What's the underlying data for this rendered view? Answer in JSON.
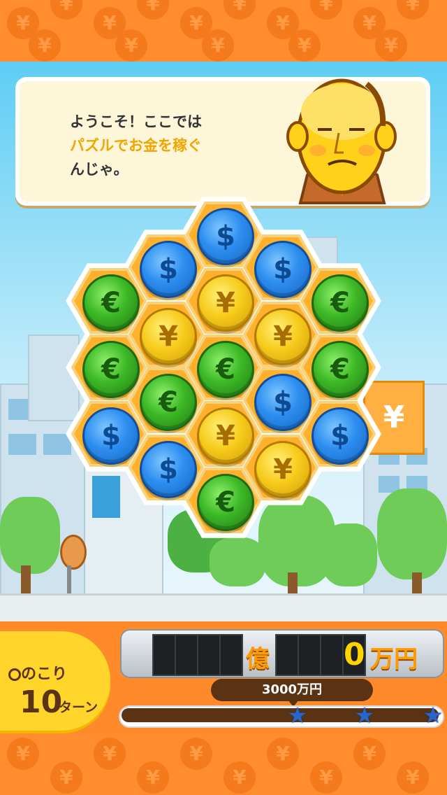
{
  "dialog": {
    "line1": "ようこそ！ここでは",
    "line2": "パズルでお金を稼ぐ",
    "line3": "んじゃ。"
  },
  "board": {
    "coins": [
      {
        "type": "blue",
        "symbol": "$"
      },
      {
        "type": "blue",
        "symbol": "$"
      },
      {
        "type": "blue",
        "symbol": "$"
      },
      {
        "type": "green",
        "symbol": "€"
      },
      {
        "type": "yellow",
        "symbol": "¥"
      },
      {
        "type": "green",
        "symbol": "€"
      },
      {
        "type": "yellow",
        "symbol": "¥"
      },
      {
        "type": "yellow",
        "symbol": "¥"
      },
      {
        "type": "green",
        "symbol": "€"
      },
      {
        "type": "green",
        "symbol": "€"
      },
      {
        "type": "green",
        "symbol": "€"
      },
      {
        "type": "green",
        "symbol": "€"
      },
      {
        "type": "blue",
        "symbol": "$"
      },
      {
        "type": "blue",
        "symbol": "$"
      },
      {
        "type": "yellow",
        "symbol": "¥"
      },
      {
        "type": "blue",
        "symbol": "$"
      },
      {
        "type": "blue",
        "symbol": "$"
      },
      {
        "type": "yellow",
        "symbol": "¥"
      },
      {
        "type": "green",
        "symbol": "€"
      }
    ]
  },
  "status": {
    "turns_label": "のこり",
    "turns_value": "10",
    "turns_unit": "ターン",
    "money_oku_digits": [
      "",
      "",
      "",
      ""
    ],
    "money_oku_unit": "億",
    "money_man_digits": [
      "",
      "",
      "",
      "0"
    ],
    "money_man_unit": "万円",
    "goal_label": "3000万円",
    "progress_fraction": 0.0
  },
  "colors": {
    "accent_orange": "#ff8a2a",
    "yellow": "#ffd52b",
    "brown": "#5a3312"
  }
}
